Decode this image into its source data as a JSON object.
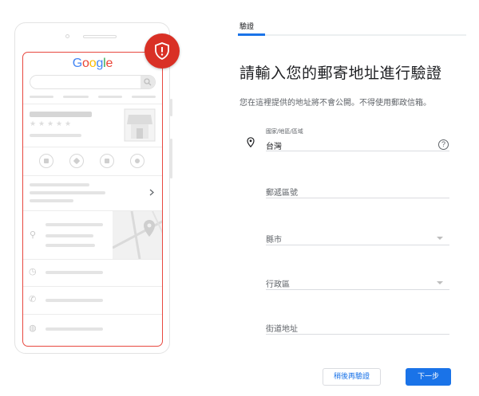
{
  "illustration": {
    "logo_letters": [
      {
        "ch": "G",
        "color": "#4285F4"
      },
      {
        "ch": "o",
        "color": "#EA4335"
      },
      {
        "ch": "o",
        "color": "#FBBC05"
      },
      {
        "ch": "g",
        "color": "#4285F4"
      },
      {
        "ch": "l",
        "color": "#34A853"
      },
      {
        "ch": "e",
        "color": "#EA4335"
      }
    ],
    "badge_color": "#D93025",
    "icons": [
      "shield-alert-icon",
      "search-icon",
      "phone-icon",
      "directions-icon",
      "save-icon",
      "website-icon",
      "chevron-right-icon",
      "location-pin-icon",
      "clock-icon",
      "phone-icon",
      "globe-icon",
      "map-pin-icon",
      "storefront-icon"
    ]
  },
  "tab": {
    "label": "驗證"
  },
  "form": {
    "title": "請輸入您的郵寄地址進行驗證",
    "subtitle": "您在這裡提供的地址將不會公開。不得使用郵政信箱。",
    "country": {
      "label": "國家/地區/區域",
      "value": "台灣",
      "help_icon": "?"
    },
    "postal_code": {
      "placeholder": "郵遞區號"
    },
    "city": {
      "placeholder": "縣市"
    },
    "district": {
      "placeholder": "行政區"
    },
    "street": {
      "placeholder": "街道地址"
    }
  },
  "buttons": {
    "later": "稍後再驗證",
    "next": "下一步"
  },
  "colors": {
    "accent": "#1A73E8",
    "badge": "#D93025",
    "screen_border": "#E8483F"
  }
}
